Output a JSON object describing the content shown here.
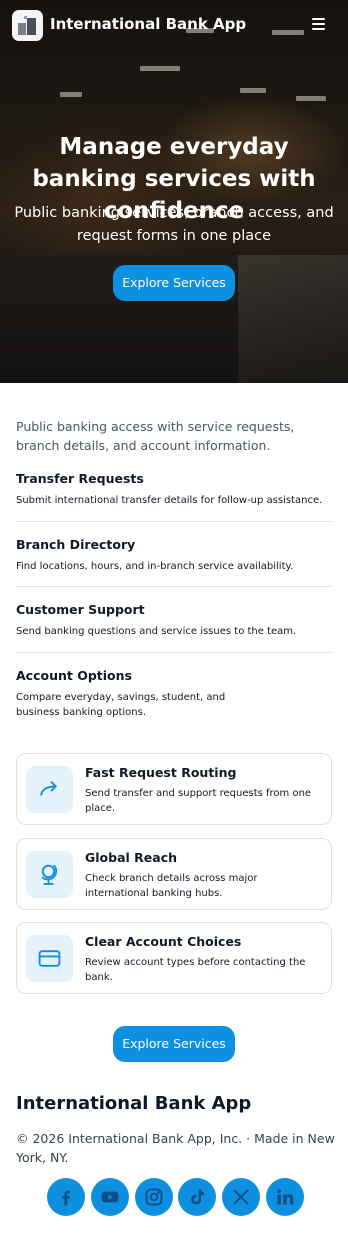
{
  "app": {
    "name": "International Bank App"
  },
  "hero": {
    "title": "Manage everyday banking services with confidence",
    "subtitle": "Public banking services, branch access, and request forms in one place",
    "cta_label": "Explore Services"
  },
  "intro": "Public banking access with service requests, branch details, and account information.",
  "services": [
    {
      "title": "Transfer Requests",
      "description": "Submit international transfer details for follow-up assistance."
    },
    {
      "title": "Branch Directory",
      "description": "Find locations, hours, and in-branch service availability."
    },
    {
      "title": "Customer Support",
      "description": "Send banking questions and service issues to the team."
    },
    {
      "title": "Account Options",
      "description": "Compare everyday, savings, student, and business banking options."
    }
  ],
  "features": [
    {
      "title": "Fast Request Routing",
      "description": "Send transfer and support requests from one place.",
      "icon": "arrow-forward-icon"
    },
    {
      "title": "Global Reach",
      "description": "Check branch details across major international banking hubs.",
      "icon": "globe-icon"
    },
    {
      "title": "Clear Account Choices",
      "description": "Review account types before contacting the bank.",
      "icon": "credit-card-icon"
    }
  ],
  "bottom_cta_label": "Explore Services",
  "footer": {
    "title": "International Bank App",
    "copyright": "© 2026 International Bank App, Inc. · Made in New York, NY.",
    "socials": [
      "facebook-icon",
      "youtube-icon",
      "instagram-icon",
      "tiktok-icon",
      "x-icon",
      "linkedin-icon"
    ]
  },
  "colors": {
    "accent": "#0e8fe0",
    "icon_bg": "#e5f1fb",
    "text": "#111827"
  }
}
